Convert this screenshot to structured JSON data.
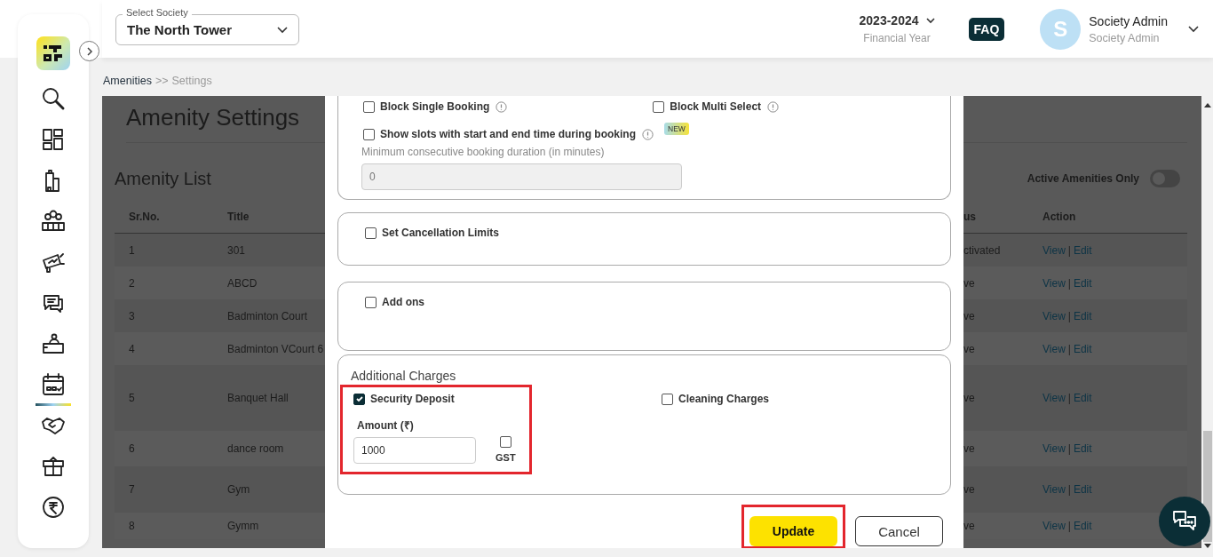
{
  "header": {
    "society_select": {
      "label": "Select Society",
      "value": "The North Tower"
    },
    "financial_year": {
      "value": "2023-2024",
      "label": "Financial Year"
    },
    "faq": "FAQ",
    "user": {
      "initial": "S",
      "name": "Society Admin",
      "role": "Society Admin"
    }
  },
  "sidebar": {
    "items": [
      {
        "selected": false
      },
      {
        "selected": false
      },
      {
        "selected": false
      },
      {
        "selected": false
      },
      {
        "selected": false
      },
      {
        "selected": false
      },
      {
        "selected": false
      },
      {
        "selected": true
      },
      {
        "selected": false
      },
      {
        "selected": false
      },
      {
        "selected": false
      }
    ]
  },
  "breadcrumb": {
    "separator": ">>",
    "items": [
      {
        "label": "Amenities",
        "current": false
      },
      {
        "label": "Settings",
        "current": true
      }
    ]
  },
  "page": {
    "title": "Amenity Settings",
    "list_title": "Amenity List",
    "active_only_toggle": {
      "label": "Active Amenities Only",
      "on": false
    }
  },
  "table": {
    "columns": [
      "Sr.No.",
      "Title",
      "us",
      "Action"
    ],
    "action_separator": "|",
    "rows": [
      {
        "sr": "1",
        "title": "301",
        "status": "ctivated",
        "actions": [
          "View",
          "Edit"
        ]
      },
      {
        "sr": "2",
        "title": "ABCD",
        "status": "ve",
        "actions": [
          "View",
          "Edit"
        ]
      },
      {
        "sr": "3",
        "title": "Badminton Court",
        "status": "ve",
        "actions": [
          "View",
          "Edit"
        ]
      },
      {
        "sr": "4",
        "title": "Badminton VCourt 6",
        "status": "ve",
        "actions": [
          "View",
          "Edit"
        ]
      },
      {
        "sr": "5",
        "title": "Banquet Hall",
        "status": "ve",
        "actions": [
          "View",
          "Edit"
        ]
      },
      {
        "sr": "6",
        "title": "dance room",
        "status": "ve",
        "actions": [
          "View",
          "Edit"
        ]
      },
      {
        "sr": "7",
        "title": "Gym",
        "status": "ve",
        "actions": [
          "View",
          "Edit"
        ]
      },
      {
        "sr": "8",
        "title": "Gymm",
        "status": "ve",
        "actions": [
          "View",
          "Edit"
        ]
      }
    ]
  },
  "modal": {
    "booking_options": {
      "row": [
        {
          "label": "Block Single Booking",
          "checked": false
        },
        {
          "label": "Block Multi Select",
          "checked": false
        }
      ],
      "slots": {
        "label": "Show slots with start and end time during booking",
        "checked": false,
        "badge": "NEW"
      },
      "min_duration": {
        "label": "Minimum consecutive booking duration (in minutes)",
        "value": "0",
        "disabled": true
      }
    },
    "toggles": [
      {
        "label": "Set Cancellation Limits",
        "checked": false
      },
      {
        "label": "Add ons",
        "checked": false
      }
    ],
    "additional_charges": {
      "title": "Additional Charges",
      "items": [
        {
          "label": "Security Deposit",
          "checked": true,
          "highlighted": true,
          "amount": {
            "label": "Amount (₹)",
            "value": "1000"
          },
          "gst": {
            "label": "GST",
            "checked": false
          }
        },
        {
          "label": "Cleaning Charges",
          "checked": false,
          "highlighted": false
        }
      ]
    },
    "buttons": [
      {
        "label": "Update",
        "kind": "primary",
        "highlighted": true
      },
      {
        "label": "Cancel",
        "kind": "secondary",
        "highlighted": false
      }
    ]
  }
}
